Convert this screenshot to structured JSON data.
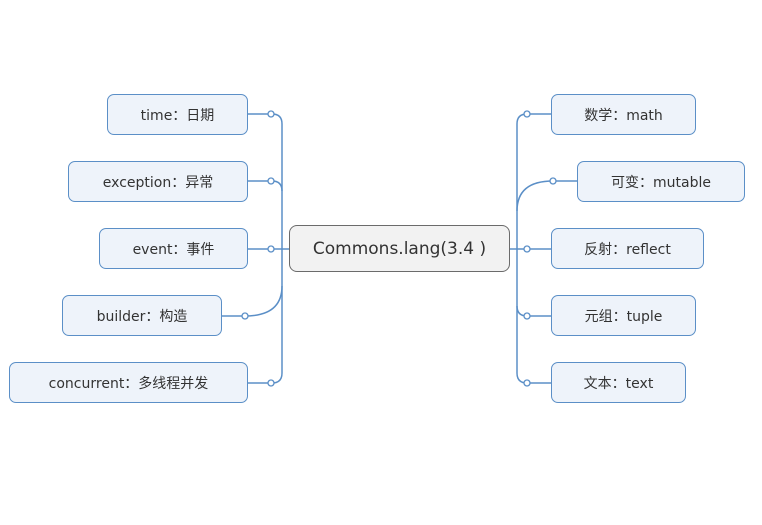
{
  "diagram": {
    "type": "mind-map",
    "colors": {
      "branch_border": "#5b8fc7",
      "branch_fill": "#eef3fa",
      "root_border": "#6b6b6b",
      "root_fill": "#f2f2f2",
      "text": "#333333"
    },
    "root": {
      "label": "Commons.lang(3.4 )"
    },
    "left_branches": [
      {
        "label": "time：日期"
      },
      {
        "label": "exception：异常"
      },
      {
        "label": "event：事件"
      },
      {
        "label": "builder：构造"
      },
      {
        "label": "concurrent：多线程并发"
      }
    ],
    "right_branches": [
      {
        "label": "数学：math"
      },
      {
        "label": "可变：mutable"
      },
      {
        "label": "反射：reflect"
      },
      {
        "label": "元组：tuple"
      },
      {
        "label": "文本：text"
      }
    ]
  }
}
